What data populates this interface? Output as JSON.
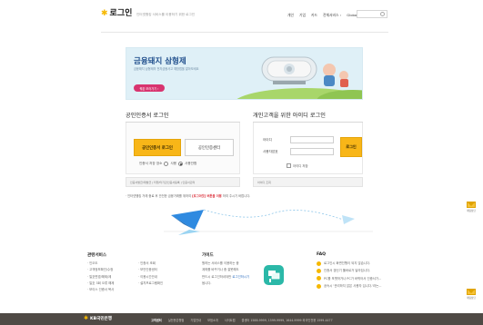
{
  "header": {
    "logo_text": "로그인",
    "tagline": "인터넷뱅킹 서비스를 이용하기 위한 로그인",
    "nav": [
      "개인",
      "기업",
      "카드",
      "전체서비스 ›",
      "Global ›"
    ]
  },
  "banner": {
    "title": "금융돼지 삼형제",
    "subtitle": "금융돼지 삼형제의 전자금융사고 예방법을 알아보세요",
    "button": "퀘존 보러가기 ›"
  },
  "cert_login": {
    "title": "공인인증서 로그인",
    "login_button": "공인인증서 로그인",
    "center_button": "공인인증센터",
    "save_label": "인증서 저장 장소",
    "radio_options": [
      "사용",
      "사용안함"
    ],
    "links": "인증서발급/재발급 | 타행/타기관인증서등록 | 인증서관리"
  },
  "id_login": {
    "title": "개인고객을 위한 아이디 로그인",
    "id_label": "아이디",
    "pw_label": "사용자암호",
    "login_button": "로그인",
    "save_label": "아이디 저장",
    "links": "아이디 조회"
  },
  "notice": {
    "prefix": "· 인터넷뱅킹 거래 중료 후 안전한 금융거래를 위하여",
    "emphasis": "[로그아웃] 버튼을 이용",
    "suffix": "하여 주시기 바랍니다."
  },
  "footer_info": {
    "related_title": "관련서비스",
    "related_left": [
      "· 인오도",
      "· 고객정보확인/수정",
      "· 일호변경/해제/제",
      "· 일호 3회 오류 해제",
      "· 보이스 인증서 복사"
    ],
    "related_right": [
      "· 인증서 조회",
      "· 보안인증센터",
      "· 이용시간안내",
      "· 설치프로그램확인"
    ],
    "guide_title": "가이드",
    "guide_lines": [
      "원하는 서비스를 이용하는 중",
      "계좌를 바꾸거나 중 잘못해도",
      "반드시 로그인하셔야만",
      "됩니다."
    ],
    "guide_link": "로그인하시기",
    "faq_title": "FAQ",
    "faq_items": [
      "로그인시 화면진행이 되지 않습니다.",
      "인증서 갱신기 툴바로거 달라집니다.",
      "PC를 포맷하거나 PC가 바뀌어서 인증서가...",
      "공속시 '관리하지 않은 사용자 입니다.'라는..."
    ]
  },
  "side": {
    "label": "채팅상담"
  },
  "bottom": {
    "brand": "KB국민은행",
    "links": [
      "고객센터",
      "실전문은행점",
      "기업안내",
      "모범소개",
      "사이트맵",
      "콜센터 1588-9999, 1599-9999, 1644-9999 외국인전용 1599-4477"
    ]
  },
  "colors": {
    "accent": "#f8b618",
    "brand_dark": "#4f4a45",
    "banner_bg": "#dff0f7",
    "banner_title": "#1f4e8c",
    "banner_button": "#d8346f",
    "warning_text": "#d9232e"
  }
}
